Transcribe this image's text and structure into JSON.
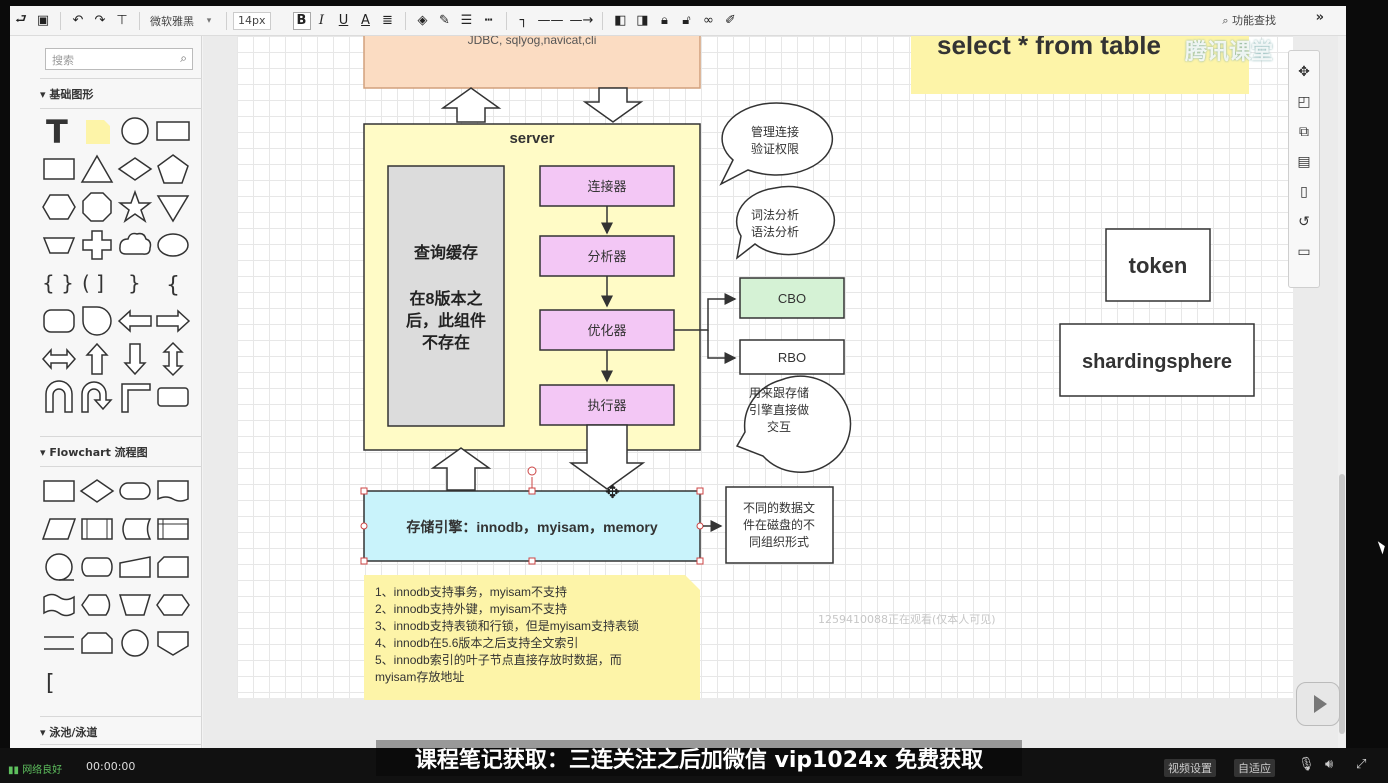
{
  "toolbar": {
    "font_family": "微软雅黑",
    "font_size": "14px",
    "bold": "B",
    "italic": "I",
    "underline": "U",
    "font_color": "A",
    "search_function": "功能查找"
  },
  "sidebar": {
    "search_placeholder": "搜索",
    "sections": [
      {
        "title": "基础图形"
      },
      {
        "title": "Flowchart 流程图"
      },
      {
        "title": "泳池/泳道"
      }
    ]
  },
  "diagram": {
    "top_box_text": "JDBC, sqlyog,navicat,cli",
    "top_sql_text": "select * from table",
    "server_title": "server",
    "query_cache": "查询缓存",
    "query_cache_note_lines": [
      "在8版本之",
      "后，此组件",
      "不存在"
    ],
    "connector": "连接器",
    "analyzer": "分析器",
    "optimizer": "优化器",
    "executor": "执行器",
    "cbo": "CBO",
    "rbo": "RBO",
    "bubble_connect": [
      "管理连接",
      "验证权限"
    ],
    "bubble_analyze": [
      "词法分析",
      "语法分析"
    ],
    "bubble_exec": [
      "用来跟存储",
      "引擎直接做",
      "交互"
    ],
    "storage_engine": "存储引擎：innodb，myisam，memory",
    "storage_note": [
      "不同的数据文",
      "件在磁盘的不",
      "同组织形式"
    ],
    "notes": [
      "1、innodb支持事务，myisam不支持",
      "2、innodb支持外键，myisam不支持",
      "3、innodb支持表锁和行锁，但是myisam支持表锁",
      "4、innodb在5.6版本之后支持全文索引",
      "5、innodb索引的叶子节点直接存放时数据，而",
      "myisam存放地址"
    ],
    "token": "token",
    "shardingsphere": "shardingsphere"
  },
  "overlay": {
    "watermark": "腾讯课堂",
    "viewers": "1259410088正在观看(仅本人可见)"
  },
  "player": {
    "network": "网络良好",
    "time": "00:00:00",
    "caption": "课程笔记获取：三连关注之后加微信 vip1024x 免费获取",
    "video_settings": "视频设置",
    "fit": "自适应"
  },
  "colors": {
    "server_fill": "#fffbc6",
    "component_fill": "#f3c7f5",
    "cache_fill": "#dcdcdc",
    "cbo_fill": "#d5f2d5",
    "storage_fill": "#c9f3fb",
    "top_box_fill": "#fbdcc2",
    "sql_note_fill": "#fdf4a8",
    "notes_fill": "#fdf4a8"
  }
}
